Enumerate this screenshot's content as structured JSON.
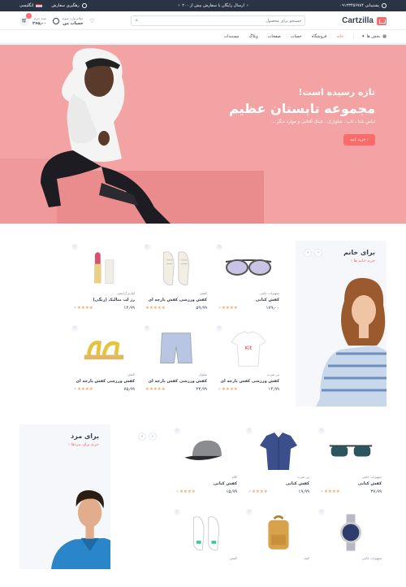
{
  "topbar": {
    "support": "پشتیبانی ۰۹۱۲۳۴۵۶۷۸۴",
    "shipping": "ارسال رایگان با سفارش بیش از ۲۰۰",
    "tracking": "رهگیری سفارش",
    "language": "انگلیسی"
  },
  "header": {
    "logo": "Cartzilla",
    "search_placeholder": "جستجو برای محصول",
    "account_top": "سلام وارد شوید",
    "account_bottom": "حساب من",
    "cart_top": "سبد خرید",
    "cart_total": "۲۶۵٫۰۰",
    "cart_count": "۶"
  },
  "nav": {
    "categories": "بخش ها",
    "items": [
      "خانه",
      "فروشگاه",
      "حساب",
      "صفحات",
      "وبلاگ",
      "مستندات"
    ]
  },
  "hero": {
    "line1": "تازه رسیده است!",
    "line2": "مجموعه تابستان عظیم",
    "line3": "لباس شنا ، تاپ ، شلوارک ، عینک آفتابی و موارد دیگر ...",
    "button": "خرید کنید"
  },
  "women": {
    "title": "برای خانم",
    "link": "خرید خانم ها",
    "products": [
      {
        "category": "تجهیزات جانبی",
        "name": "کفش کتانی",
        "price": "۱۷۹٫۰۰",
        "stars": 4,
        "img": "sunglasses"
      },
      {
        "category": "کفش",
        "name": "کفش ورزشی کفش پارچه ای",
        "price": "۵۹٫۹۹",
        "stars": 5,
        "img": "sneakers"
      },
      {
        "category": "لوازم آرایشی",
        "name": "رژ لب متالیک (رنگی)",
        "price": "۱۴٫۹۹",
        "stars": 4,
        "img": "lipstick"
      },
      {
        "category": "تی شرت",
        "name": "کفش ورزشی کفش پارچه ای",
        "price": "۱۴٫۹۹",
        "stars": 4,
        "img": "tshirt"
      },
      {
        "category": "شلوار",
        "name": "کفش ورزشی کفش پارچه ای",
        "price": "۲۴٫۹۹",
        "stars": 5,
        "img": "shorts"
      },
      {
        "category": "کفش",
        "name": "کفش ورزشی کفش پارچه ای",
        "price": "۷۵٫۹۹",
        "stars": 4,
        "img": "sandals"
      }
    ]
  },
  "men": {
    "title": "برای مرد",
    "link": "خرید برای مردها",
    "products": [
      {
        "category": "تجهیزات جانبی",
        "name": "کفش کتانی",
        "price": "۳۷٫۹۹",
        "stars": 4,
        "img": "msunglasses"
      },
      {
        "category": "تی شرت",
        "name": "کفش کتانی",
        "price": "۱۹٫۹۹",
        "stars": 4,
        "img": "shirt"
      },
      {
        "category": "کلاه",
        "name": "کفش کتانی",
        "price": "۱۵٫۹۹",
        "stars": 4,
        "img": "cap"
      },
      {
        "category": "تجهیزات جانبی",
        "name": "",
        "price": "",
        "stars": 0,
        "img": "watch"
      },
      {
        "category": "کیف",
        "name": "",
        "price": "",
        "stars": 0,
        "img": "backpack"
      },
      {
        "category": "کفش",
        "name": "",
        "price": "",
        "stars": 0,
        "img": "whitesneakers"
      }
    ]
  },
  "colors": {
    "accent": "#fe696a",
    "dark": "#2b3445",
    "hero_bg": "#f3a3a4",
    "star": "#fea569"
  }
}
